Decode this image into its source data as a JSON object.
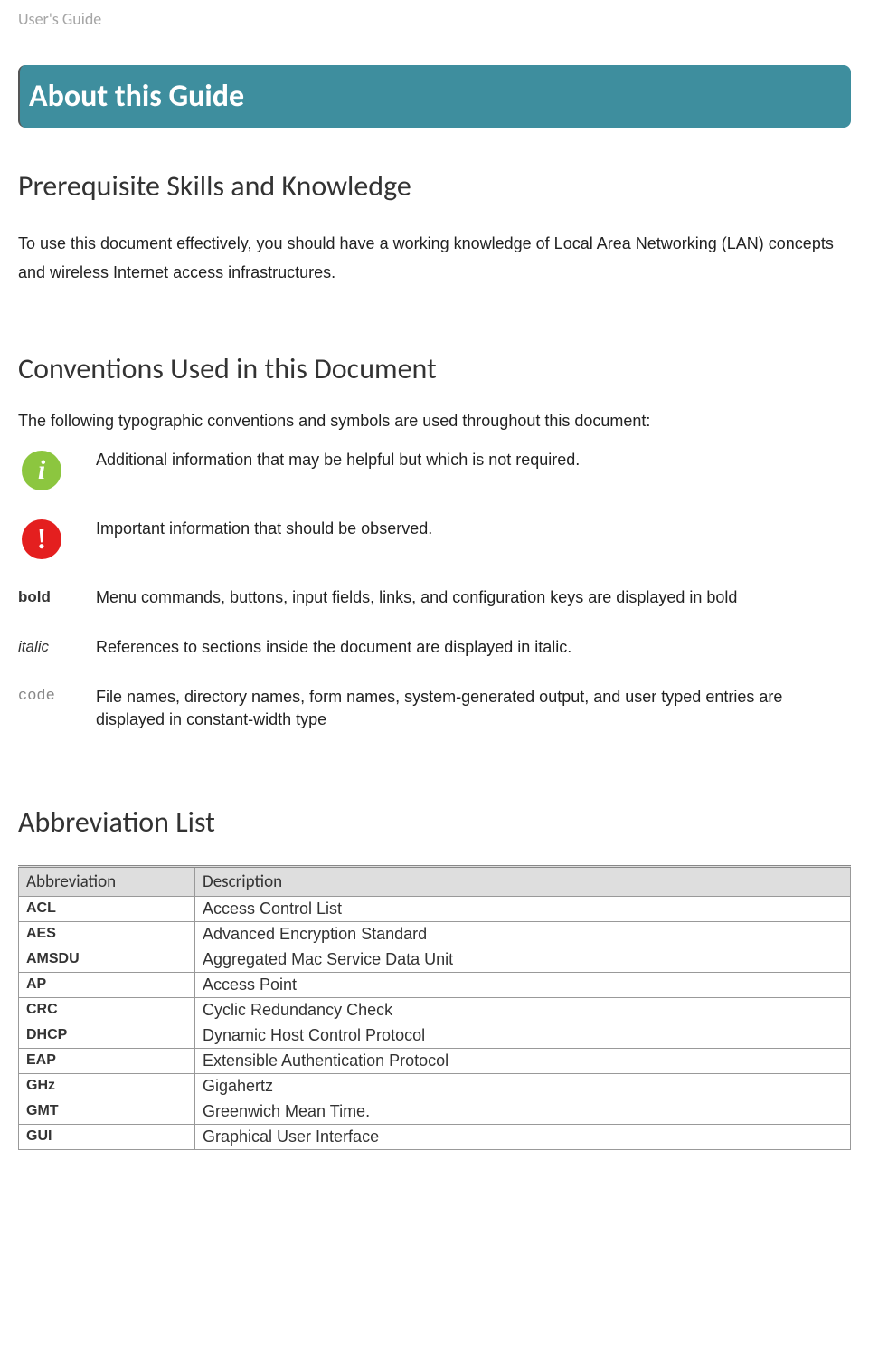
{
  "header": {
    "running_title": "User's Guide"
  },
  "banner": {
    "title": "About this Guide"
  },
  "sec1": {
    "heading": "Prerequisite Skills and Knowledge",
    "body": "To use this document effectively, you should have a working knowledge of Local Area Networking (LAN) concepts and wireless Internet access infrastructures."
  },
  "sec2": {
    "heading": "Conventions Used in this Document",
    "intro": "The following typographic conventions and symbols are used throughout this document:",
    "rows": {
      "info": {
        "desc": "Additional information that may be helpful but which is not required."
      },
      "warn": {
        "desc": "Important information that should be observed."
      },
      "bold": {
        "label": "bold",
        "desc": "Menu commands, buttons, input fields, links, and configuration keys are displayed in bold"
      },
      "italic": {
        "label": "italic",
        "desc": "References to sections inside the document are displayed in italic."
      },
      "code": {
        "label": "code",
        "desc": "File names, directory names, form names, system-generated output, and user typed entries are displayed in constant-width type"
      }
    }
  },
  "sec3": {
    "heading": "Abbreviation List",
    "col1": "Abbreviation",
    "col2": "Description",
    "rows": [
      {
        "ab": "ACL",
        "de": "Access Control List"
      },
      {
        "ab": "AES",
        "de": "Advanced Encryption Standard"
      },
      {
        "ab": "AMSDU",
        "de": "Aggregated Mac Service Data Unit"
      },
      {
        "ab": "AP",
        "de": "Access Point"
      },
      {
        "ab": "CRC",
        "de": "Cyclic Redundancy Check"
      },
      {
        "ab": "DHCP",
        "de": "Dynamic Host Control Protocol"
      },
      {
        "ab": "EAP",
        "de": " Extensible Authentication Protocol"
      },
      {
        "ab": "GHz",
        "de": "Gigahertz"
      },
      {
        "ab": "GMT",
        "de": "Greenwich Mean Time."
      },
      {
        "ab": "GUI",
        "de": "Graphical User Interface"
      }
    ]
  }
}
